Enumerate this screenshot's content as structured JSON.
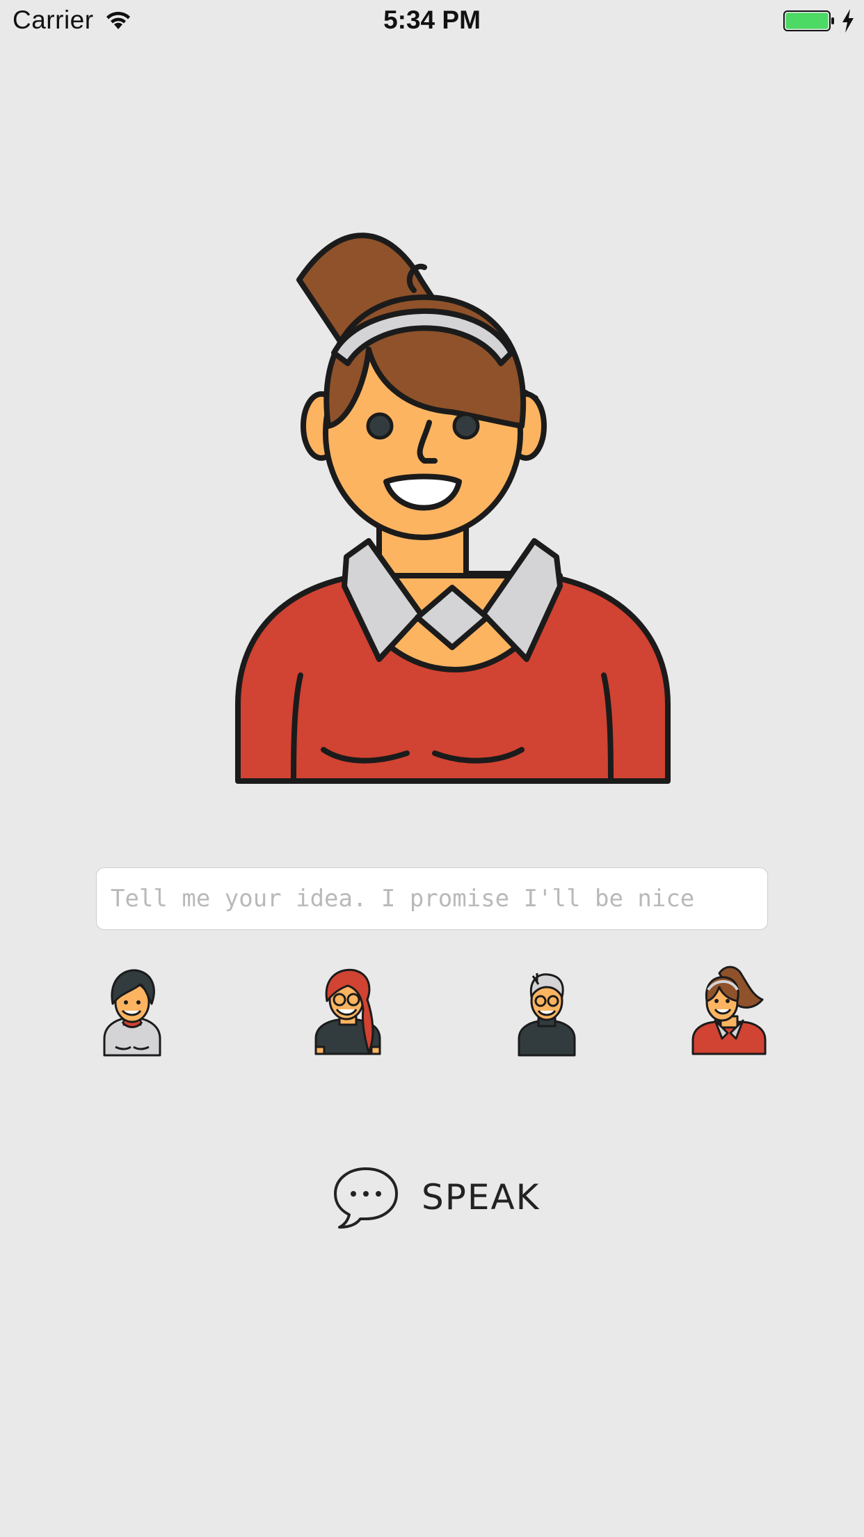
{
  "status_bar": {
    "carrier": "Carrier",
    "time": "5:34 PM",
    "battery_color": "#4cd964"
  },
  "hero": {
    "icon": "woman-ponytail-red-sweater-avatar"
  },
  "idea_input": {
    "value": "",
    "placeholder": "Tell me your idea. I promise I'll be nice"
  },
  "personas": [
    {
      "icon": "woman-dark-hair-gray-top-avatar"
    },
    {
      "icon": "woman-red-hair-glasses-avatar"
    },
    {
      "icon": "old-man-glasses-avatar"
    },
    {
      "icon": "woman-ponytail-red-sweater-avatar",
      "selected": true
    }
  ],
  "speak": {
    "label": "SPEAK",
    "icon": "speech-bubble-icon"
  },
  "colors": {
    "background": "#e9e9ea",
    "skin": "#fcb461",
    "hair_brown": "#8f522a",
    "sweater_red": "#d14332",
    "outline": "#1b1b1b",
    "collar_gray": "#d4d4d6",
    "dark_slate": "#323b3e"
  }
}
